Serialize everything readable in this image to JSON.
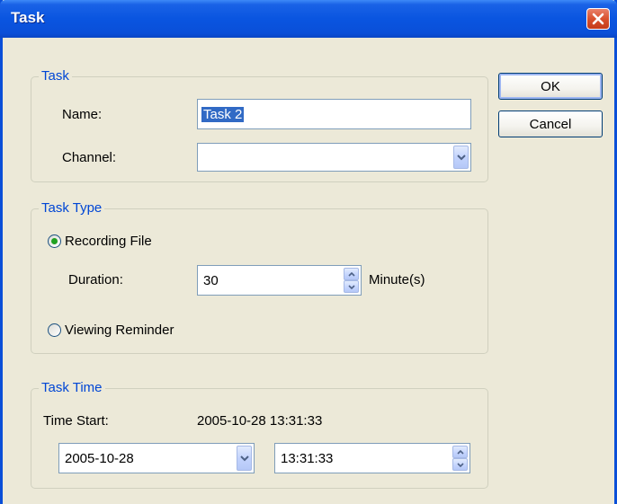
{
  "window": {
    "title": "Task",
    "close_icon": "close-icon"
  },
  "buttons": {
    "ok_label": "OK",
    "cancel_label": "Cancel"
  },
  "task_group": {
    "legend": "Task",
    "name_label": "Name:",
    "name_value": "Task 2",
    "channel_label": "Channel:",
    "channel_value": ""
  },
  "task_type_group": {
    "legend": "Task Type",
    "recording_label": "Recording File",
    "recording_selected": true,
    "duration_label": "Duration:",
    "duration_value": "30",
    "duration_unit": "Minute(s)",
    "viewing_label": "Viewing Reminder",
    "viewing_selected": false
  },
  "task_time_group": {
    "legend": "Task Time",
    "time_start_label": "Time Start:",
    "time_start_value": "2005-10-28 13:31:33",
    "date_value": "2005-10-28",
    "time_value": "13:31:33"
  },
  "colors": {
    "title_bar": "#0a4fd8",
    "legend_text": "#0046d5",
    "dialog_bg": "#ece9d8",
    "close_button": "#d9512e",
    "selection": "#316ac5"
  }
}
